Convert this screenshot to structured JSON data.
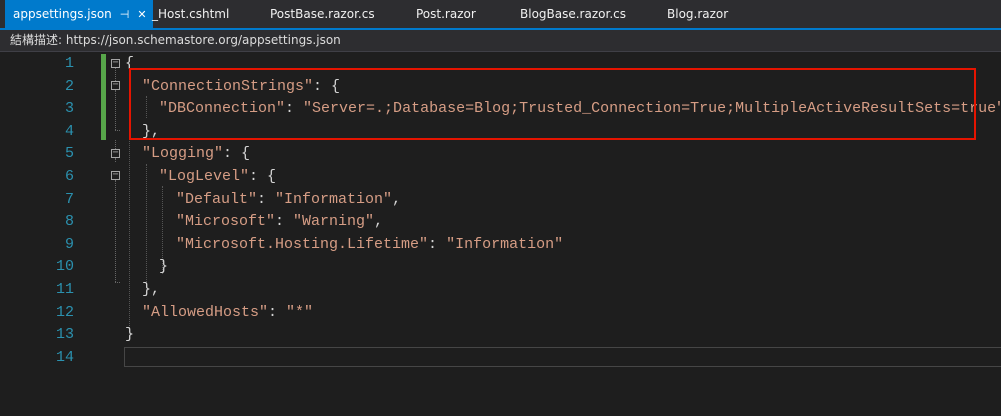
{
  "tabs": [
    {
      "label": "appsettings.json",
      "active": true,
      "pin_glyph": "⊣",
      "close_glyph": "✕"
    },
    {
      "label": "_Host.cshtml"
    },
    {
      "label": "PostBase.razor.cs"
    },
    {
      "label": "Post.razor"
    },
    {
      "label": "BlogBase.razor.cs"
    },
    {
      "label": "Blog.razor"
    }
  ],
  "schema_bar": {
    "text": "結構描述:  https://json.schemastore.org/appsettings.json"
  },
  "editor": {
    "line_numbers": [
      "1",
      "2",
      "3",
      "4",
      "5",
      "6",
      "7",
      "8",
      "9",
      "10",
      "11",
      "12",
      "13",
      "14"
    ],
    "lines": [
      [
        {
          "t": "{",
          "c": "punc"
        }
      ],
      [
        {
          "t": "\"ConnectionStrings\"",
          "c": "str"
        },
        {
          "t": ": {",
          "c": "punc"
        }
      ],
      [
        {
          "t": "\"DBConnection\"",
          "c": "str"
        },
        {
          "t": ": ",
          "c": "punc"
        },
        {
          "t": "\"Server=.;Database=Blog;Trusted_Connection=True;MultipleActiveResultSets=true\"",
          "c": "str"
        }
      ],
      [
        {
          "t": "},",
          "c": "punc"
        }
      ],
      [
        {
          "t": "\"Logging\"",
          "c": "str"
        },
        {
          "t": ": {",
          "c": "punc"
        }
      ],
      [
        {
          "t": "\"LogLevel\"",
          "c": "str"
        },
        {
          "t": ": {",
          "c": "punc"
        }
      ],
      [
        {
          "t": "\"Default\"",
          "c": "str"
        },
        {
          "t": ": ",
          "c": "punc"
        },
        {
          "t": "\"Information\"",
          "c": "str"
        },
        {
          "t": ",",
          "c": "punc"
        }
      ],
      [
        {
          "t": "\"Microsoft\"",
          "c": "str"
        },
        {
          "t": ": ",
          "c": "punc"
        },
        {
          "t": "\"Warning\"",
          "c": "str"
        },
        {
          "t": ",",
          "c": "punc"
        }
      ],
      [
        {
          "t": "\"Microsoft.Hosting.Lifetime\"",
          "c": "str"
        },
        {
          "t": ": ",
          "c": "punc"
        },
        {
          "t": "\"Information\"",
          "c": "str"
        }
      ],
      [
        {
          "t": "}",
          "c": "punc"
        }
      ],
      [
        {
          "t": "},",
          "c": "punc"
        }
      ],
      [
        {
          "t": "\"AllowedHosts\"",
          "c": "str"
        },
        {
          "t": ": ",
          "c": "punc"
        },
        {
          "t": "\"*\"",
          "c": "str"
        }
      ],
      [
        {
          "t": "}",
          "c": "punc"
        }
      ],
      []
    ],
    "fold_glyph": "−"
  },
  "colors": {
    "string": "#d69d85",
    "punctuation": "#d4d4d4",
    "line_number": "#2b91af",
    "highlight_box": "#e51400",
    "active_tab": "#007acc"
  }
}
